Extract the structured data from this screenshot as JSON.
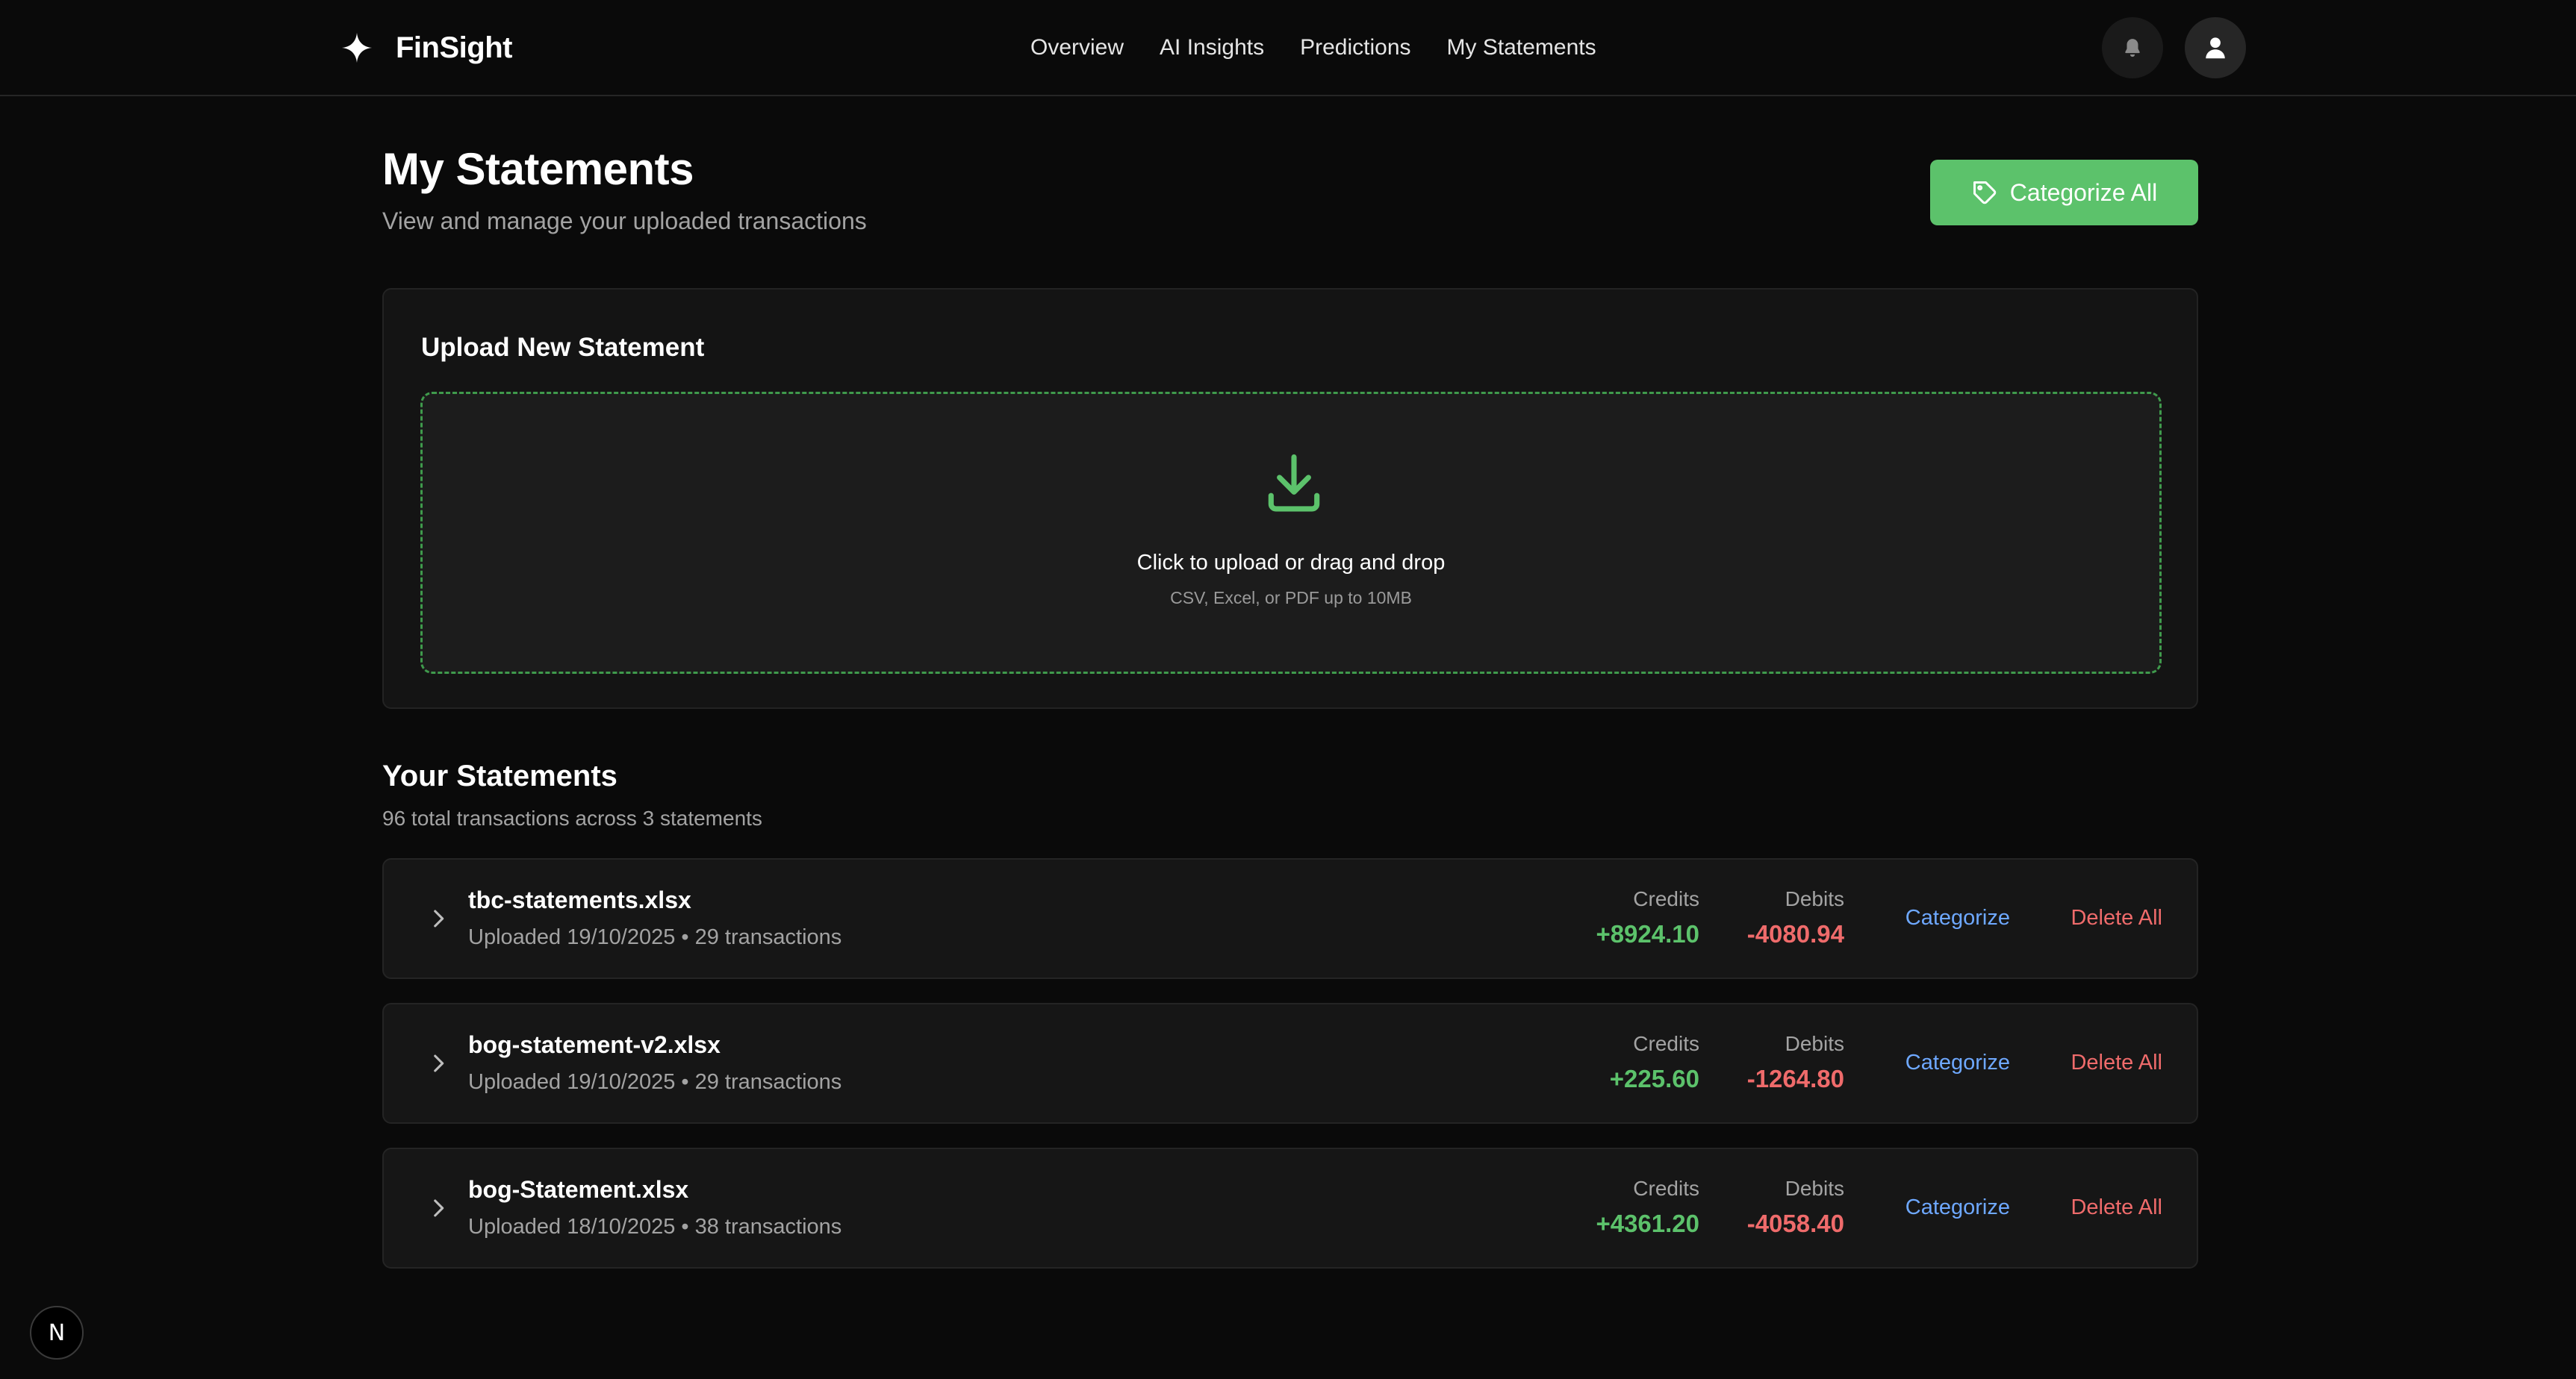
{
  "brand": {
    "name": "FinSight",
    "logo_icon": "sparkle-icon"
  },
  "nav": {
    "items": [
      {
        "label": "Overview"
      },
      {
        "label": "AI Insights"
      },
      {
        "label": "Predictions"
      },
      {
        "label": "My Statements"
      }
    ],
    "icons": [
      "bell-icon",
      "user-icon"
    ]
  },
  "header": {
    "title": "My Statements",
    "subtitle": "View and manage your uploaded transactions",
    "categorize_all_label": "Categorize All",
    "categorize_all_icon": "tag-icon"
  },
  "upload": {
    "title": "Upload New Statement",
    "icon": "download-icon",
    "main_text": "Click to upload or drag and drop",
    "hint_text": "CSV, Excel, or PDF up to 10MB"
  },
  "statements": {
    "title": "Your Statements",
    "summary": "96 total transactions across 3 statements",
    "credits_label": "Credits",
    "debits_label": "Debits",
    "categorize_label": "Categorize",
    "delete_label": "Delete All",
    "items": [
      {
        "filename": "tbc-statements.xlsx",
        "meta": "Uploaded 19/10/2025 • 29 transactions",
        "credits": "+8924.10",
        "debits": "-4080.94"
      },
      {
        "filename": "bog-statement-v2.xlsx",
        "meta": "Uploaded 19/10/2025 • 29 transactions",
        "credits": "+225.60",
        "debits": "-1264.80"
      },
      {
        "filename": "bog-Statement.xlsx",
        "meta": "Uploaded 18/10/2025 • 38 transactions",
        "credits": "+4361.20",
        "debits": "-4058.40"
      }
    ]
  },
  "badge": {
    "letter": "N"
  },
  "colors": {
    "accent_green": "#5cc26b",
    "link_blue": "#6ea8ff",
    "danger_red": "#ef6b6b",
    "background": "#0a0a0a"
  }
}
